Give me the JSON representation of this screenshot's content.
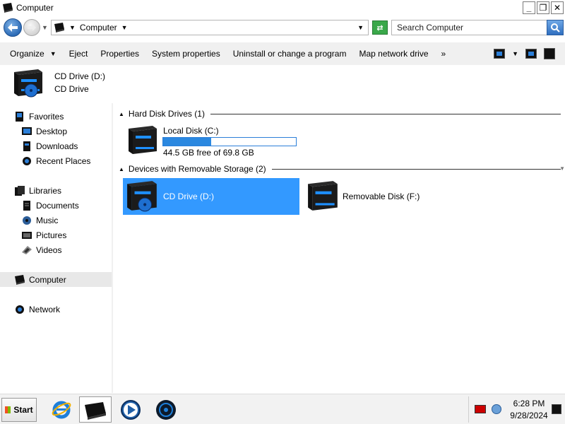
{
  "window": {
    "title": "Computer"
  },
  "window_buttons": {
    "minimize": "_",
    "restore": "❐",
    "close": "✕"
  },
  "address": {
    "location": "Computer"
  },
  "search": {
    "placeholder": "Search Computer"
  },
  "toolbar": {
    "organize": "Organize",
    "eject": "Eject",
    "properties": "Properties",
    "system_properties": "System properties",
    "uninstall": "Uninstall or change a program",
    "map_drive": "Map network drive",
    "more": "»"
  },
  "details": {
    "name": "CD Drive (D:)",
    "type": "CD Drive"
  },
  "nav": {
    "favorites": "Favorites",
    "desktop": "Desktop",
    "downloads": "Downloads",
    "recent": "Recent Places",
    "libraries": "Libraries",
    "documents": "Documents",
    "music": "Music",
    "pictures": "Pictures",
    "videos": "Videos",
    "computer": "Computer",
    "network": "Network"
  },
  "groups": {
    "hdd": "Hard Disk Drives (1)",
    "removable": "Devices with Removable Storage (2)"
  },
  "drives": {
    "c": {
      "name": "Local Disk (C:)",
      "free_text": "44.5 GB free of 69.8 GB",
      "used_fraction": 0.362
    },
    "d": {
      "name": "CD Drive (D:)"
    },
    "f": {
      "name": "Removable Disk (F:)"
    }
  },
  "taskbar": {
    "start": "Start",
    "time": "6:28 PM",
    "date": "9/28/2024"
  },
  "colors": {
    "selection": "#3399ff",
    "progress": "#2b88e0",
    "drive_accent": "#1e90ff"
  },
  "icons": {
    "app": "computer-icon",
    "back": "back-arrow-icon",
    "forward": "forward-arrow-icon",
    "refresh": "refresh-icon",
    "search": "magnifier-icon",
    "drive": "hard-drive-icon",
    "cd": "cd-drive-icon",
    "ie": "internet-explorer-icon",
    "media": "media-player-icon"
  }
}
